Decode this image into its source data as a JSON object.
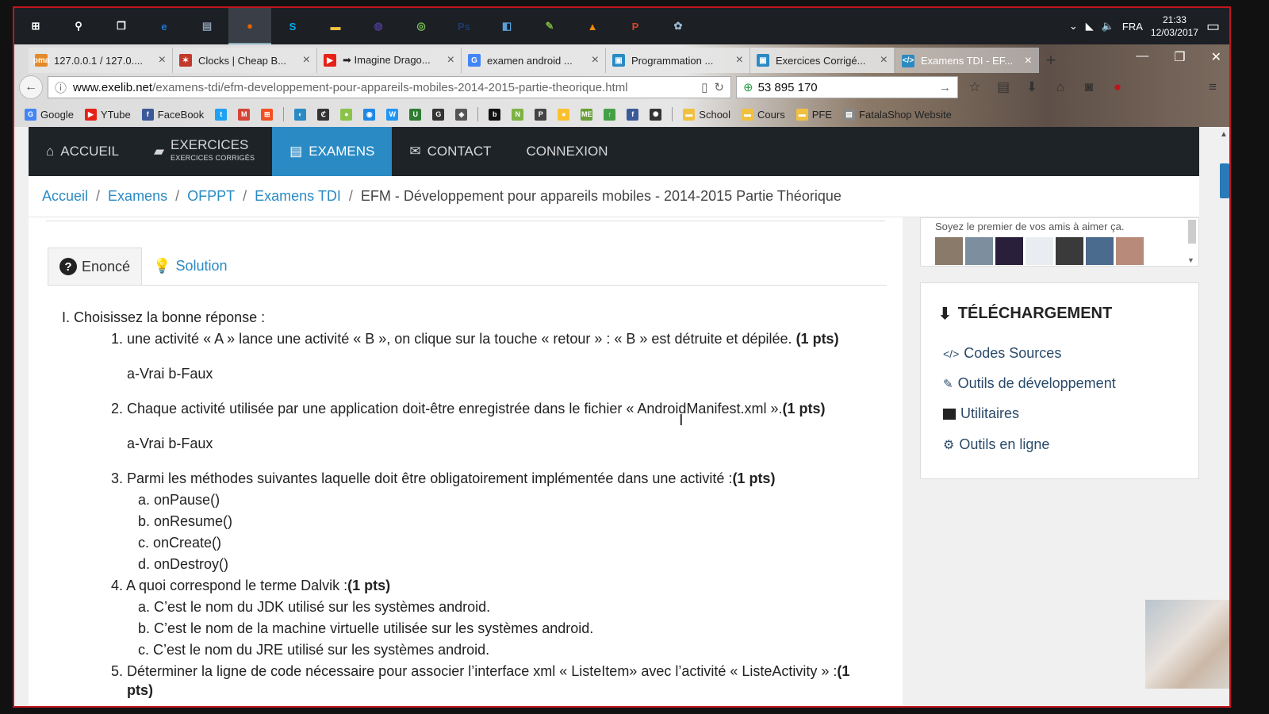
{
  "taskbar": {
    "apps": [
      {
        "icon": "windows-start-icon",
        "glyph": "⊞",
        "color": "#ffffff"
      },
      {
        "icon": "search-icon",
        "glyph": "⚲",
        "color": "#ffffff"
      },
      {
        "icon": "task-view-icon",
        "glyph": "❐",
        "color": "#ffffff"
      },
      {
        "icon": "edge-icon",
        "glyph": "e",
        "color": "#1e78d7"
      },
      {
        "icon": "printer-icon",
        "glyph": "▤",
        "color": "#8a9bb0"
      },
      {
        "icon": "firefox-icon",
        "glyph": "●",
        "color": "#e66000"
      },
      {
        "icon": "skype-icon",
        "glyph": "S",
        "color": "#00aff0"
      },
      {
        "icon": "file-explorer-icon",
        "glyph": "▬",
        "color": "#f0c040"
      },
      {
        "icon": "eclipse-icon",
        "glyph": "◍",
        "color": "#4b3a8a"
      },
      {
        "icon": "android-studio-icon",
        "glyph": "◎",
        "color": "#78c257"
      },
      {
        "icon": "photoshop-icon",
        "glyph": "Ps",
        "color": "#1c3b6f"
      },
      {
        "icon": "notepad-icon",
        "glyph": "◧",
        "color": "#5aa0d8"
      },
      {
        "icon": "notepadpp-icon",
        "glyph": "✎",
        "color": "#7bb241"
      },
      {
        "icon": "vlc-icon",
        "glyph": "▲",
        "color": "#f08a00"
      },
      {
        "icon": "powerpoint-icon",
        "glyph": "P",
        "color": "#d24726"
      },
      {
        "icon": "paint-icon",
        "glyph": "✿",
        "color": "#9bb8d0"
      }
    ],
    "active_index": 5,
    "language": "FRA",
    "time": "21:33",
    "date": "12/03/2017"
  },
  "browser": {
    "tabs": [
      {
        "title": "127.0.0.1 / 127.0....",
        "favicon_color": "#e58a2a",
        "favicon_text": "pma"
      },
      {
        "title": "Clocks | Cheap B...",
        "favicon_color": "#c0392b",
        "favicon_text": "✶"
      },
      {
        "title": "➡ Imagine Drago...",
        "favicon_color": "#e62117",
        "favicon_text": "▶"
      },
      {
        "title": "examen android ...",
        "favicon_color": "#4285f4",
        "favicon_text": "G"
      },
      {
        "title": "Programmation ...",
        "favicon_color": "#2a8ac4",
        "favicon_text": "▣"
      },
      {
        "title": "Exercices Corrigé...",
        "favicon_color": "#2a8ac4",
        "favicon_text": "▣"
      },
      {
        "title": "Examens TDI - EF...",
        "favicon_color": "#2a8ac4",
        "favicon_text": "</>"
      }
    ],
    "active_tab_index": 6,
    "url_domain": "www.exelib.net",
    "url_path": "/examens-tdi/efm-developpement-pour-appareils-mobiles-2014-2015-partie-theorique.html",
    "search_value": "53 895 170",
    "bookmarks": [
      {
        "label": "Google",
        "color": "#4285f4",
        "glyph": "G"
      },
      {
        "label": "YTube",
        "color": "#e62117",
        "glyph": "▶"
      },
      {
        "label": "FaceBook",
        "color": "#3b5998",
        "glyph": "f"
      },
      {
        "label": "",
        "color": "#1da1f2",
        "glyph": "t"
      },
      {
        "label": "",
        "color": "#d44638",
        "glyph": "M"
      },
      {
        "label": "",
        "color": "#f25022",
        "glyph": "⊞"
      },
      {
        "label": "",
        "color": "#2a8ac4",
        "glyph": "◐"
      },
      {
        "label": "",
        "color": "#333333",
        "glyph": "ℭ"
      },
      {
        "label": "",
        "color": "#8bc34a",
        "glyph": "●"
      },
      {
        "label": "",
        "color": "#1e88e5",
        "glyph": "◉"
      },
      {
        "label": "",
        "color": "#2196f3",
        "glyph": "W"
      },
      {
        "label": "",
        "color": "#2e7d32",
        "glyph": "U"
      },
      {
        "label": "",
        "color": "#333333",
        "glyph": "G"
      },
      {
        "label": "",
        "color": "#555555",
        "glyph": "◈"
      },
      {
        "label": "",
        "color": "#111111",
        "glyph": "b"
      },
      {
        "label": "",
        "color": "#7cb342",
        "glyph": "N"
      },
      {
        "label": "",
        "color": "#444444",
        "glyph": "P"
      },
      {
        "label": "",
        "color": "#fbc02d",
        "glyph": "●"
      },
      {
        "label": "",
        "color": "#689f38",
        "glyph": "ME"
      },
      {
        "label": "",
        "color": "#43a047",
        "glyph": "↑"
      },
      {
        "label": "",
        "color": "#3b5998",
        "glyph": "f"
      },
      {
        "label": "",
        "color": "#333333",
        "glyph": "✺"
      },
      {
        "label": "School",
        "color": "#f0c040",
        "glyph": "▬"
      },
      {
        "label": "Cours",
        "color": "#f0c040",
        "glyph": "▬"
      },
      {
        "label": "PFE",
        "color": "#f0c040",
        "glyph": "▬"
      },
      {
        "label": "FatalaShop Website",
        "color": "#888888",
        "glyph": "▤"
      }
    ]
  },
  "site": {
    "nav": [
      {
        "label": "Accueil",
        "icon": "home-icon",
        "glyph": "⌂",
        "sub": ""
      },
      {
        "label": "Exercices",
        "icon": "book-icon",
        "glyph": "▰",
        "sub": "Exercices corrigés"
      },
      {
        "label": "Examens",
        "icon": "document-icon",
        "glyph": "▤",
        "sub": ""
      },
      {
        "label": "Contact",
        "icon": "envelope-icon",
        "glyph": "✉",
        "sub": ""
      },
      {
        "label": "Connexion",
        "icon": "",
        "glyph": "",
        "sub": ""
      }
    ],
    "active_nav": 2,
    "accent": "#2a8ac4",
    "breadcrumb": [
      "Accueil",
      "Examens",
      "OFPPT",
      "Examens TDI"
    ],
    "breadcrumb_current": "EFM - Développement pour appareils mobiles - 2014-2015 Partie Théorique",
    "content_tabs": [
      {
        "label": "Enoncé",
        "icon": "question-circle-icon"
      },
      {
        "label": "Solution",
        "icon": "lightbulb-icon"
      }
    ],
    "article": {
      "heading": "I. Choisissez la bonne réponse :",
      "q1": "1. une activité « A » lance une activité « B », on clique sur la touche « retour » : « B » est détruite et dépilée.",
      "q1_pts": "(1 pts)",
      "q1_ans": "a-Vrai  b-Faux",
      "q2": "2. Chaque activité utilisée par une application doit-être enregistrée dans le fichier « AndroidManifest.xml ».",
      "q2_pts": "(1 pts)",
      "q2_ans": "a-Vrai  b-Faux",
      "q3": "3. Parmi les méthodes  suivantes laquelle  doit être obligatoirement implémentée dans une activité :",
      "q3_pts": "(1 pts)",
      "q3_a": "a. onPause()",
      "q3_b": "b. onResume()",
      "q3_c": "c. onCreate()",
      "q3_d": "d. onDestroy()",
      "q4": "4. A quoi correspond le terme Dalvik :",
      "q4_pts": "(1 pts)",
      "q4_a": "a. C’est le nom du JDK utilisé sur les systèmes android.",
      "q4_b": "b. C’est le nom de la machine virtuelle utilisée sur les systèmes android.",
      "q4_c": "c. C’est le nom du JRE utilisé sur les systèmes android.",
      "q5": "5. Déterminer la  ligne de code nécessaire pour associer l’interface xml « ListeItem» avec l’activité « ListeActivity » :",
      "q5_pts": "(1",
      "q5_cont": "pts)"
    },
    "like_box_text": "Soyez le premier de vos amis à aimer ça.",
    "download": {
      "title": "TÉLÉCHARGEMENT",
      "links": [
        {
          "label": "Codes Sources",
          "icon": "code-icon",
          "glyph": "</>"
        },
        {
          "label": "Outils de développement",
          "icon": "wrench-icon",
          "glyph": "🔧"
        },
        {
          "label": "Utilitaires",
          "icon": "terminal-icon",
          "glyph": "▪"
        },
        {
          "label": "Outils en ligne",
          "icon": "gears-icon",
          "glyph": "⚙"
        }
      ]
    }
  }
}
